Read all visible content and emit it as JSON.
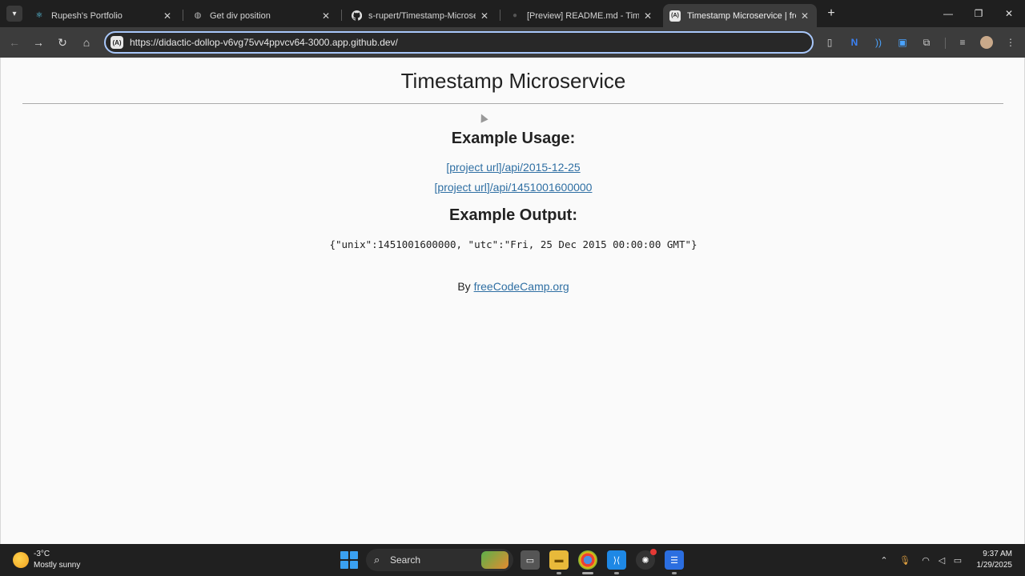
{
  "browser": {
    "tabs": [
      {
        "title": "Rupesh's Portfolio",
        "icon": "react-icon"
      },
      {
        "title": "Get div position",
        "icon": "globe-icon"
      },
      {
        "title": "s-rupert/Timestamp-Microservice",
        "icon": "github-icon"
      },
      {
        "title": "[Preview] README.md - Timestamp",
        "icon": "vscode-icon"
      },
      {
        "title": "Timestamp Microservice | freeCodeCamp",
        "icon": "site-a-icon",
        "active": true
      }
    ],
    "url": "https://didactic-dollop-v6vg75vv4ppvcv64-3000.app.github.dev/",
    "site_icon_text": "(A)",
    "close_glyph": "✕",
    "new_tab_glyph": "+"
  },
  "page": {
    "title": "Timestamp Microservice",
    "usage_heading": "Example Usage:",
    "links": [
      "[project url]/api/2015-12-25",
      "[project url]/api/1451001600000"
    ],
    "output_heading": "Example Output:",
    "output_code": "{\"unix\":1451001600000, \"utc\":\"Fri, 25 Dec 2015 00:00:00 GMT\"}",
    "byline_prefix": "By ",
    "byline_link": "freeCodeCamp.org"
  },
  "taskbar": {
    "weather_temp": "-3°C",
    "weather_desc": "Mostly sunny",
    "search_label": "Search",
    "time": "9:37 AM",
    "date": "1/29/2025"
  },
  "colors": {
    "link": "#2f6fa3",
    "omnibox_focus": "#a8c7fa",
    "tabstrip": "#1f1f1f",
    "toolbar": "#3c3c3c",
    "taskbar": "#202020"
  }
}
